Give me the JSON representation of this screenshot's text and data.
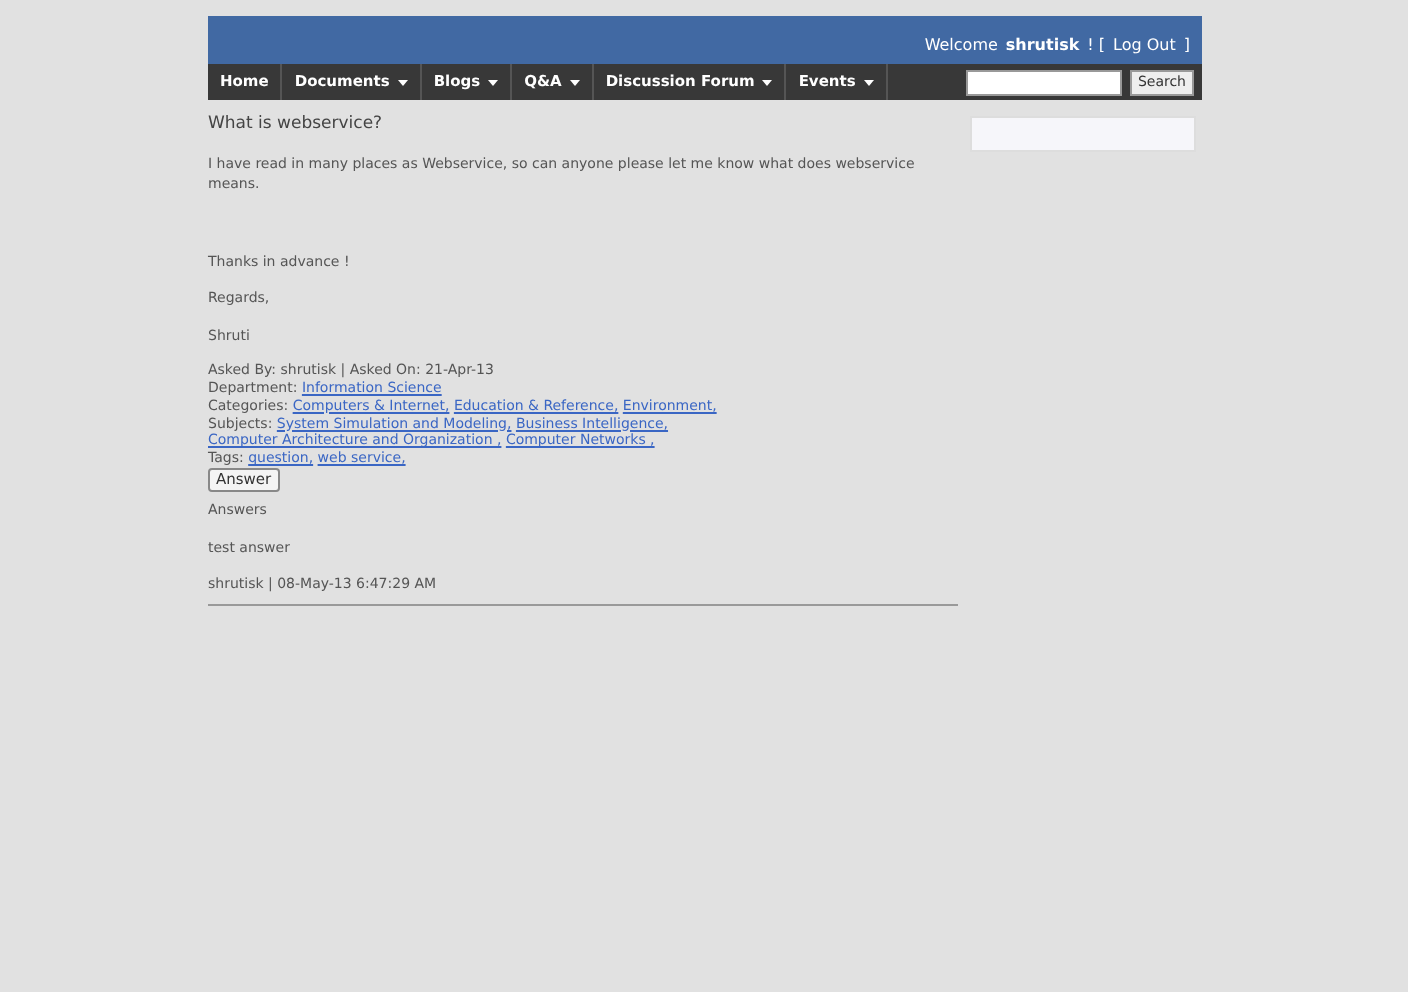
{
  "header": {
    "welcome": "Welcome",
    "user": "shrutisk",
    "after_user": "! [",
    "logout": "Log Out",
    "close_bracket": "]"
  },
  "nav": {
    "items": [
      {
        "label": "Home",
        "has_menu": false
      },
      {
        "label": "Documents",
        "has_menu": true
      },
      {
        "label": "Blogs",
        "has_menu": true
      },
      {
        "label": "Q&A",
        "has_menu": true
      },
      {
        "label": "Discussion Forum",
        "has_menu": true
      },
      {
        "label": "Events",
        "has_menu": true
      }
    ],
    "search_button": "Search"
  },
  "question": {
    "title": "What is webservice?",
    "body": [
      "I have read in many places as Webservice, so can anyone please let me know what does webservice means.",
      "Thanks in advance !",
      "Regards,",
      "Shruti"
    ],
    "asked": "Asked By: shrutisk | Asked On: 21-Apr-13",
    "meta": [
      {
        "label": "Department:",
        "links": [
          "Information Science"
        ]
      },
      {
        "label": "Categories:",
        "links": [
          "Computers & Internet,",
          "Education & Reference,",
          "Environment,"
        ]
      },
      {
        "label": "Subjects:",
        "links": [
          "System Simulation and Modeling,",
          "Business Intelligence,",
          "Computer Architecture and Organization ,",
          "Computer Networks ,"
        ]
      },
      {
        "label": "Tags:",
        "links": [
          "question,",
          "web service,"
        ]
      }
    ],
    "answer_button": "Answer"
  },
  "answers": {
    "heading": "Answers",
    "items": [
      {
        "text": "test answer",
        "byline": "shrutisk | 08-May-13 6:47:29 AM"
      }
    ]
  }
}
